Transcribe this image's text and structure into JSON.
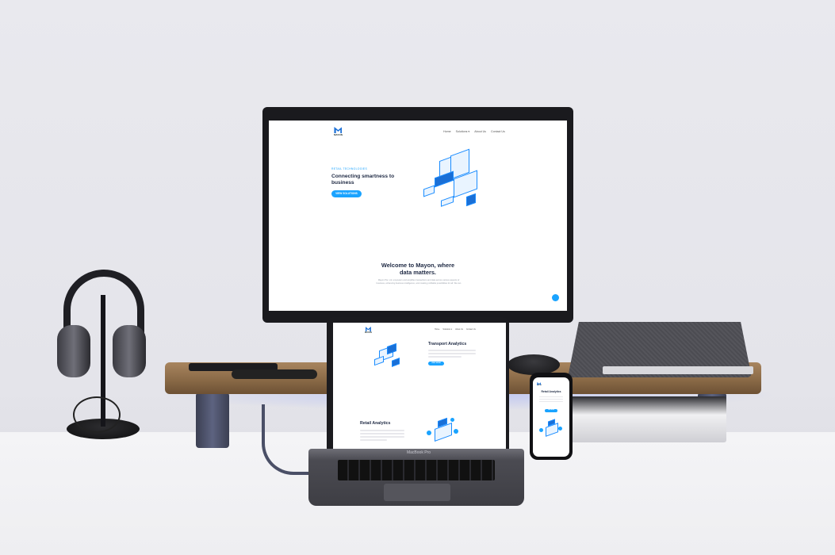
{
  "monitor": {
    "brand": "MAYON",
    "nav": [
      "Home",
      "Solutions ▾",
      "About Us",
      "Contact Us"
    ],
    "hero_tagline": "RETAIL TECHNOLOGIES",
    "hero_heading": "Connecting smartness to business",
    "hero_button": "VIEW SOLUTIONS",
    "welcome_heading": "Welcome to Mayon, where data matters.",
    "welcome_body": "Mayon Pte. Ltd. empowers and amplifies transactions and data across various aspects of business, enhancing business intelligence, and creating profitable possibilities for all. We can"
  },
  "laptop": {
    "brand": "MAYON",
    "nav": [
      "Home",
      "Solutions ▾",
      "About Us",
      "Contact Us"
    ],
    "section1_heading": "Transport Analytics",
    "section1_button": "VIEW MORE",
    "section2_heading": "Retail Analytics",
    "model_label": "MacBook Pro"
  },
  "phone": {
    "brand": "MAYON",
    "heading": "Retail Analytics",
    "button": "VIEW MORE"
  },
  "colors": {
    "accent": "#1aa3ff",
    "brand_blue": "#1a6fd6",
    "heading_text": "#1f2a44"
  }
}
